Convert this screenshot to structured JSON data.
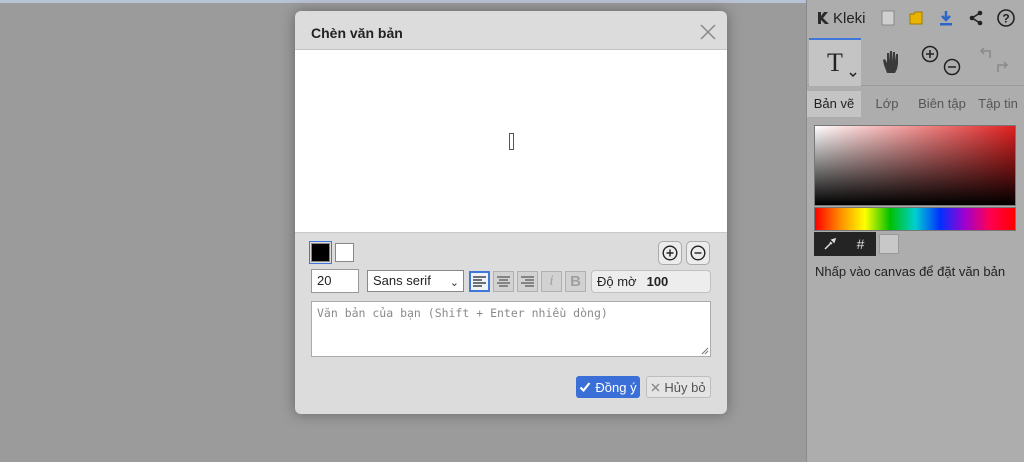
{
  "app": {
    "name": "Kleki",
    "tabs": [
      "Bản vẽ",
      "Lớp",
      "Biên tập",
      "Tập tin"
    ],
    "hint": "Nhấp vào canvas để đặt văn bản",
    "hex_button": "#",
    "tool_text_glyph": "T"
  },
  "dialog": {
    "title": "Chèn văn bản",
    "font_size_value": "20",
    "font_family_selected": "Sans serif",
    "italic_label": "i",
    "bold_label": "B",
    "opacity_label": "Độ mờ",
    "opacity_value": "100",
    "text_placeholder": "Văn bản của bạn (Shift + Enter nhiều dòng)",
    "ok_label": "Đồng ý",
    "cancel_label": "Hủy bỏ",
    "fg_color": "#000000",
    "bg_color": "#ffffff"
  },
  "colors": {
    "accent": "#3a6fd8",
    "overlay": "#9b9b9b"
  }
}
